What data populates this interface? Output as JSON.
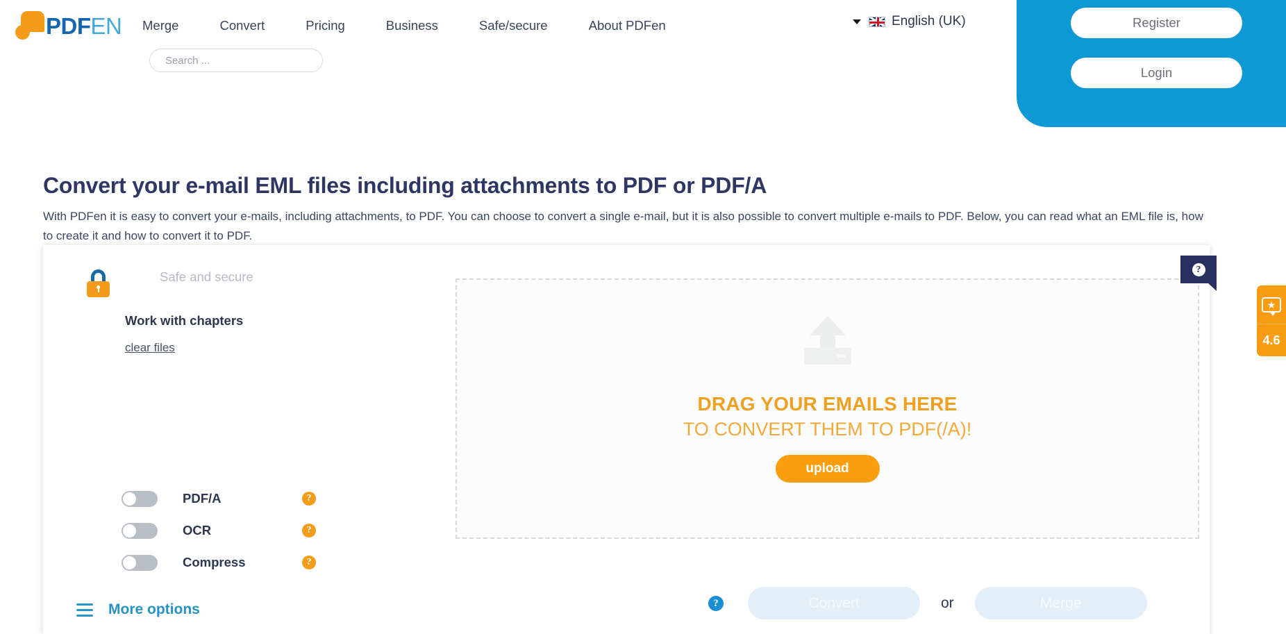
{
  "header": {
    "logo": {
      "part1": "PDF",
      "part2": "EN"
    },
    "nav": [
      {
        "label": "Merge"
      },
      {
        "label": "Convert"
      },
      {
        "label": "Pricing"
      },
      {
        "label": "Business"
      },
      {
        "label": "Safe/secure"
      },
      {
        "label": "About PDFen"
      }
    ],
    "search": {
      "value": "",
      "placeholder": "Search ..."
    },
    "language": {
      "label": "English (UK)",
      "flag_icon": "uk-flag-icon",
      "caret_icon": "caret-down-icon"
    },
    "auth": {
      "register_label": "Register",
      "login_label": "Login"
    }
  },
  "main": {
    "title": "Convert your e-mail EML files including attachments to PDF or PDF/A",
    "description": "With PDFen it is easy to convert your e-mails, including attachments, to PDF. You can choose to convert a single e-mail, but it is also possible to convert multiple e-mails to PDF. Below, you can read what an EML file is, how to create it and how to convert it to PDF."
  },
  "tool": {
    "safe_label": "Safe and secure",
    "chapters_label": "Work with chapters",
    "clear_files_label": "clear files",
    "lock_icon": "lock-icon",
    "options": [
      {
        "label": "PDF/A",
        "state": "off",
        "help_icon": "help-circle-icon"
      },
      {
        "label": "OCR",
        "state": "off",
        "help_icon": "help-circle-icon"
      },
      {
        "label": "Compress",
        "state": "off",
        "help_icon": "help-circle-icon"
      }
    ],
    "more_options_label": "More options",
    "more_options_icon": "hamburger-menu-icon",
    "dropzone": {
      "upload_icon": "upload-arrow-icon",
      "title": "DRAG YOUR EMAILS HERE",
      "subtitle": "TO CONVERT THEM TO PDF(/A)!",
      "upload_button_label": "upload"
    },
    "actions": {
      "help_icon": "help-circle-icon",
      "convert_label": "Convert",
      "or_label": "or",
      "merge_label": "Merge"
    }
  },
  "widgets": {
    "help_tab": {
      "icon": "question-mark-icon",
      "label": "?"
    },
    "rating": {
      "star_icon": "star-bubble-icon",
      "score": "4.6"
    }
  },
  "colors": {
    "brand_orange": "#F59B1A",
    "brand_blue": "#0d9ad4",
    "logo_blue_dark": "#1565b0",
    "logo_blue_light": "#3FA9DC",
    "text_navy": "#2e3650",
    "navy_dark": "#27305e"
  }
}
